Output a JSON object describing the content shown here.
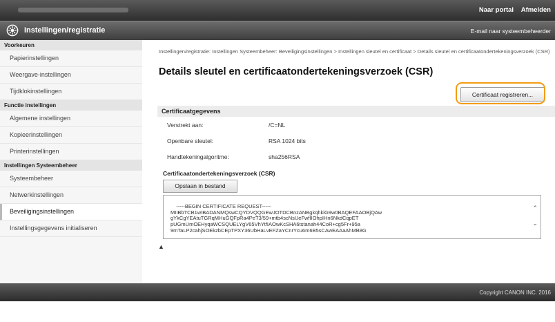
{
  "top_bar": {
    "portal_link": "Naar portal",
    "logout_link": "Afmelden"
  },
  "app_bar": {
    "title": "Instellingen/registratie",
    "mail_link": "E-mail naar systeembeheerder"
  },
  "sidebar": {
    "sections": [
      {
        "label": "Voorkeuren",
        "items": [
          "Papierinstellingen",
          "Weergave-instellingen",
          "Tijdklokinstellingen"
        ]
      },
      {
        "label": "Functie instellingen",
        "items": [
          "Algemene instellingen",
          "Kopieerinstellingen",
          "Printerinstellingen"
        ]
      },
      {
        "label": "Instellingen Systeembeheer",
        "items": [
          "Systeembeheer",
          "Netwerkinstellingen",
          "Beveiligingsinstellingen",
          "Instellingsgegevens initialiseren"
        ]
      }
    ],
    "active_item": "Beveiligingsinstellingen"
  },
  "main": {
    "breadcrumb": "Instellingen/registratie: Instellingen Systeembeheer: Beveiligingsinstellingen > Instellingen sleutel en certificaat > Details sleutel en certificaatondertekeningsverzoek (CSR)",
    "page_title": "Details sleutel en certificaatondertekeningsverzoek (CSR)",
    "register_button": "Certificaat registreren...",
    "cert_section": {
      "title": "Certificaatgegevens",
      "rows": [
        {
          "key": "Verstrekt aan:",
          "value": "/C=NL"
        },
        {
          "key": "Openbare sleutel:",
          "value": "RSA 1024 bits"
        },
        {
          "key": "Handtekeningalgoritme:",
          "value": "sha256RSA"
        }
      ]
    },
    "csr_section": {
      "title": "Certificaatondertekeningsverzoek (CSR)",
      "save_button": "Opslaan in bestand",
      "content": "-----BEGIN CERTIFICATE REQUEST-----\nMIIBbTCB1wIBADANMQswCQYDVQQGEwJOTDCBnzANBgkqhkiG9w0BAQEFAAOBjQAw\ngYkCgYEAtuTGRqMHuGQFpRa4PeT3/59+mtb4scNsUeFwfIIOhpIHn6NkdCqpET\npUGmUmOEHyqaWCSQUELYgV65VhYtfIAOwKcSHA6tstanah44CoR+cg5Fr+95a\n9mTaLP2cahjSOEkzbCEpTPXY36UbHaLvEFZaYCnrYcu6m6B5sCAwEAAaAhMB8G"
    },
    "top_link_icon": "back-to-top-icon"
  },
  "footer": {
    "copyright": "Copyright CANON INC. 2016"
  },
  "colors": {
    "highlight": "#f39c12",
    "bar_dark": "#3e3e3e"
  }
}
